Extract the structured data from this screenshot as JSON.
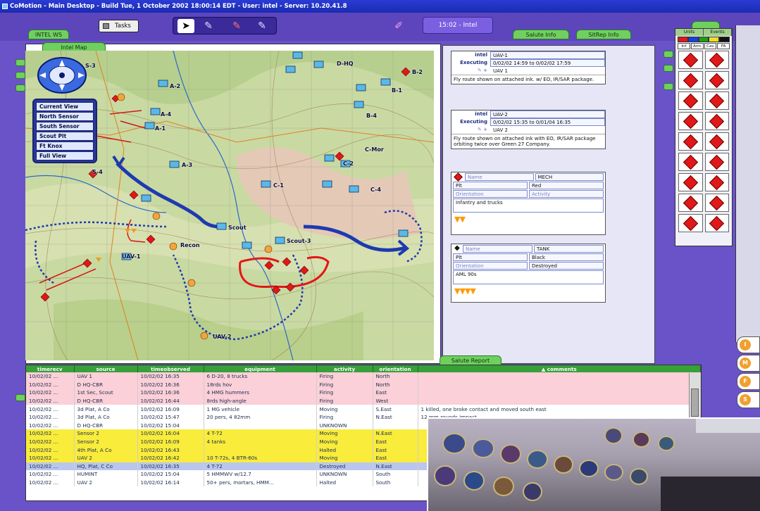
{
  "window": {
    "title": "CoMotion - Main Desktop - Build Tue, 1 October 2002 18:00:14 EDT - User: intel - Server: 10.20.41.8"
  },
  "toolbar": {
    "workspace_tab": "INTEL WS",
    "tasks_label": "Tasks",
    "clock": "15:02 - Intel",
    "tab_salute_info": "Salute Info",
    "tab_sitrep_info": "SitRep Info"
  },
  "map": {
    "tab_label": "Intel Map",
    "view_menu": [
      "Current View",
      "North Sensor",
      "South Sensor",
      "Scout Plt",
      "Ft Knox",
      "Full View"
    ],
    "unit_labels": [
      "S-3",
      "A-2",
      "A-4",
      "A-1",
      "A-3",
      "B-1",
      "B-2",
      "B-4",
      "C-Mor",
      "C-2",
      "C-4",
      "C-1",
      "S-4",
      "Scout",
      "Scout-3",
      "UAV-1",
      "UAV-2",
      "Recon",
      "D-HQ"
    ]
  },
  "tasks": [
    {
      "org": "intel",
      "status": "Executing",
      "title": "UAV-1",
      "time": "0/02/02 14:59 to 0/02/02 17:59",
      "name": "UAV 1",
      "description": "Fly route shown on attached ink. w/ EO, IR/SAR package."
    },
    {
      "org": "intel",
      "status": "Executing",
      "title": "UAV-2",
      "time": "0/02/02 15:35 to 0/01/04 16:35",
      "name": "UAV 2",
      "description": "Fly route shown on attached ink with EO, IR/SAR package orbiting twice over Green 27 Company."
    }
  ],
  "symbol_cards": [
    {
      "name_ph": "Name",
      "type": "MECH",
      "echelon": "Plt",
      "affiliation": "Red",
      "orientation_ph": "Orientation",
      "activity_ph": "Activity",
      "description": "Infantry and trucks",
      "chevrons": "▼▼"
    },
    {
      "name_ph": "Name",
      "type": "TANK",
      "echelon": "Plt",
      "affiliation": "Black",
      "orientation_ph": "Orientation",
      "activity": "Destroyed",
      "description": "AML 90s",
      "chevrons": "▼▼▼▼"
    }
  ],
  "palette": {
    "tabs": [
      "Units",
      "Events"
    ],
    "subtabs": [
      "Inf",
      "Arm",
      "Cav",
      "FA"
    ]
  },
  "report": {
    "tab_label": "Salute Report",
    "columns": [
      "timerecv",
      "source",
      "timeobserved",
      "equipment",
      "activity",
      "orientation",
      "▲ comments"
    ],
    "rows": [
      {
        "timerecv": "10/02/02 ...",
        "source": "UAV 1",
        "timeobserved": "10/02/02 16:35",
        "equipment": "6 D-20, 8 trucks",
        "activity": "Firing",
        "orientation": "North",
        "comments": "",
        "color": "#fbd0d8"
      },
      {
        "timerecv": "10/02/02 ...",
        "source": "D HQ-CBR",
        "timeobserved": "10/02/02 16:36",
        "equipment": "18rds hov",
        "activity": "Firing",
        "orientation": "North",
        "comments": "",
        "color": "#fbd0d8"
      },
      {
        "timerecv": "10/02/02 ...",
        "source": "1st Sec, Scout",
        "timeobserved": "10/02/02 16:36",
        "equipment": "4 HMG hummers",
        "activity": "Firing",
        "orientation": "East",
        "comments": "",
        "color": "#fbd0d8"
      },
      {
        "timerecv": "10/02/02 ...",
        "source": "D HQ-CBR",
        "timeobserved": "10/02/02 16:44",
        "equipment": "8rds high-angle",
        "activity": "Firing",
        "orientation": "West",
        "comments": "",
        "color": "#fbd0d8"
      },
      {
        "timerecv": "10/02/02 ...",
        "source": "3d Plat, A Co",
        "timeobserved": "10/02/02 16:09",
        "equipment": "1 MG vehicle",
        "activity": "Moving",
        "orientation": "S.East",
        "comments": "1 killed, one broke contact and moved south east",
        "color": "#ffffff"
      },
      {
        "timerecv": "10/02/02 ...",
        "source": "3d Plat, A Co",
        "timeobserved": "10/02/02 15:47",
        "equipment": "20 pers, 4 82mm",
        "activity": "Firing",
        "orientation": "N.East",
        "comments": "12 mm rounds impact ...",
        "color": "#ffffff"
      },
      {
        "timerecv": "10/02/02 ...",
        "source": "D HQ-CBR",
        "timeobserved": "10/02/02 15:04",
        "equipment": "",
        "activity": "UNKNOWN",
        "orientation": "",
        "comments": "",
        "color": "#ffffff"
      },
      {
        "timerecv": "10/02/02 ...",
        "source": "Sensor 2",
        "timeobserved": "10/02/02 16:04",
        "equipment": "4 T-72",
        "activity": "Moving",
        "orientation": "N.East",
        "comments": "",
        "color": "#f9ec3a"
      },
      {
        "timerecv": "10/02/02 ...",
        "source": "Sensor 2",
        "timeobserved": "10/02/02 16:09",
        "equipment": "4 tanks",
        "activity": "Moving",
        "orientation": "East",
        "comments": "",
        "color": "#f9ec3a"
      },
      {
        "timerecv": "10/02/02 ...",
        "source": "4th Plat, A Co",
        "timeobserved": "10/02/02 16:43",
        "equipment": "",
        "activity": "Halted",
        "orientation": "East",
        "comments": "",
        "color": "#f9ec3a"
      },
      {
        "timerecv": "10/02/02 ...",
        "source": "UAV 2",
        "timeobserved": "10/02/02 16:42",
        "equipment": "10 T-72s, 4 BTR-60s",
        "activity": "Moving",
        "orientation": "East",
        "comments": "",
        "color": "#f9ec3a"
      },
      {
        "timerecv": "10/02/02 ...",
        "source": "HQ, Plat, C Co",
        "timeobserved": "10/02/02 16:35",
        "equipment": "4 T-72",
        "activity": "Destroyed",
        "orientation": "N.East",
        "comments": "",
        "color": "#b9c6ee"
      },
      {
        "timerecv": "10/02/02 ...",
        "source": "HUMINT",
        "timeobserved": "10/02/02 15:04",
        "equipment": "5 HMMWV w/12.7",
        "activity": "UNKNOWN",
        "orientation": "South",
        "comments": "",
        "color": "#ffffff"
      },
      {
        "timerecv": "10/02/02 ...",
        "source": "UAV 2",
        "timeobserved": "10/02/02 16:14",
        "equipment": "50+ pers, mortars, HMM...",
        "activity": "Halted",
        "orientation": "South",
        "comments": "",
        "color": "#ffffff"
      }
    ]
  },
  "alerts": [
    "I",
    "M",
    "F",
    "S"
  ]
}
